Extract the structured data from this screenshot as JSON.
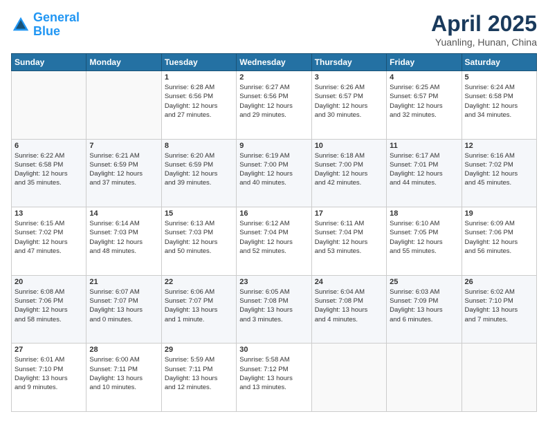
{
  "header": {
    "logo_line1": "General",
    "logo_line2": "Blue",
    "title": "April 2025",
    "location": "Yuanling, Hunan, China"
  },
  "days_of_week": [
    "Sunday",
    "Monday",
    "Tuesday",
    "Wednesday",
    "Thursday",
    "Friday",
    "Saturday"
  ],
  "weeks": [
    [
      {
        "day": "",
        "info": ""
      },
      {
        "day": "",
        "info": ""
      },
      {
        "day": "1",
        "info": "Sunrise: 6:28 AM\nSunset: 6:56 PM\nDaylight: 12 hours\nand 27 minutes."
      },
      {
        "day": "2",
        "info": "Sunrise: 6:27 AM\nSunset: 6:56 PM\nDaylight: 12 hours\nand 29 minutes."
      },
      {
        "day": "3",
        "info": "Sunrise: 6:26 AM\nSunset: 6:57 PM\nDaylight: 12 hours\nand 30 minutes."
      },
      {
        "day": "4",
        "info": "Sunrise: 6:25 AM\nSunset: 6:57 PM\nDaylight: 12 hours\nand 32 minutes."
      },
      {
        "day": "5",
        "info": "Sunrise: 6:24 AM\nSunset: 6:58 PM\nDaylight: 12 hours\nand 34 minutes."
      }
    ],
    [
      {
        "day": "6",
        "info": "Sunrise: 6:22 AM\nSunset: 6:58 PM\nDaylight: 12 hours\nand 35 minutes."
      },
      {
        "day": "7",
        "info": "Sunrise: 6:21 AM\nSunset: 6:59 PM\nDaylight: 12 hours\nand 37 minutes."
      },
      {
        "day": "8",
        "info": "Sunrise: 6:20 AM\nSunset: 6:59 PM\nDaylight: 12 hours\nand 39 minutes."
      },
      {
        "day": "9",
        "info": "Sunrise: 6:19 AM\nSunset: 7:00 PM\nDaylight: 12 hours\nand 40 minutes."
      },
      {
        "day": "10",
        "info": "Sunrise: 6:18 AM\nSunset: 7:00 PM\nDaylight: 12 hours\nand 42 minutes."
      },
      {
        "day": "11",
        "info": "Sunrise: 6:17 AM\nSunset: 7:01 PM\nDaylight: 12 hours\nand 44 minutes."
      },
      {
        "day": "12",
        "info": "Sunrise: 6:16 AM\nSunset: 7:02 PM\nDaylight: 12 hours\nand 45 minutes."
      }
    ],
    [
      {
        "day": "13",
        "info": "Sunrise: 6:15 AM\nSunset: 7:02 PM\nDaylight: 12 hours\nand 47 minutes."
      },
      {
        "day": "14",
        "info": "Sunrise: 6:14 AM\nSunset: 7:03 PM\nDaylight: 12 hours\nand 48 minutes."
      },
      {
        "day": "15",
        "info": "Sunrise: 6:13 AM\nSunset: 7:03 PM\nDaylight: 12 hours\nand 50 minutes."
      },
      {
        "day": "16",
        "info": "Sunrise: 6:12 AM\nSunset: 7:04 PM\nDaylight: 12 hours\nand 52 minutes."
      },
      {
        "day": "17",
        "info": "Sunrise: 6:11 AM\nSunset: 7:04 PM\nDaylight: 12 hours\nand 53 minutes."
      },
      {
        "day": "18",
        "info": "Sunrise: 6:10 AM\nSunset: 7:05 PM\nDaylight: 12 hours\nand 55 minutes."
      },
      {
        "day": "19",
        "info": "Sunrise: 6:09 AM\nSunset: 7:06 PM\nDaylight: 12 hours\nand 56 minutes."
      }
    ],
    [
      {
        "day": "20",
        "info": "Sunrise: 6:08 AM\nSunset: 7:06 PM\nDaylight: 12 hours\nand 58 minutes."
      },
      {
        "day": "21",
        "info": "Sunrise: 6:07 AM\nSunset: 7:07 PM\nDaylight: 13 hours\nand 0 minutes."
      },
      {
        "day": "22",
        "info": "Sunrise: 6:06 AM\nSunset: 7:07 PM\nDaylight: 13 hours\nand 1 minute."
      },
      {
        "day": "23",
        "info": "Sunrise: 6:05 AM\nSunset: 7:08 PM\nDaylight: 13 hours\nand 3 minutes."
      },
      {
        "day": "24",
        "info": "Sunrise: 6:04 AM\nSunset: 7:08 PM\nDaylight: 13 hours\nand 4 minutes."
      },
      {
        "day": "25",
        "info": "Sunrise: 6:03 AM\nSunset: 7:09 PM\nDaylight: 13 hours\nand 6 minutes."
      },
      {
        "day": "26",
        "info": "Sunrise: 6:02 AM\nSunset: 7:10 PM\nDaylight: 13 hours\nand 7 minutes."
      }
    ],
    [
      {
        "day": "27",
        "info": "Sunrise: 6:01 AM\nSunset: 7:10 PM\nDaylight: 13 hours\nand 9 minutes."
      },
      {
        "day": "28",
        "info": "Sunrise: 6:00 AM\nSunset: 7:11 PM\nDaylight: 13 hours\nand 10 minutes."
      },
      {
        "day": "29",
        "info": "Sunrise: 5:59 AM\nSunset: 7:11 PM\nDaylight: 13 hours\nand 12 minutes."
      },
      {
        "day": "30",
        "info": "Sunrise: 5:58 AM\nSunset: 7:12 PM\nDaylight: 13 hours\nand 13 minutes."
      },
      {
        "day": "",
        "info": ""
      },
      {
        "day": "",
        "info": ""
      },
      {
        "day": "",
        "info": ""
      }
    ]
  ]
}
